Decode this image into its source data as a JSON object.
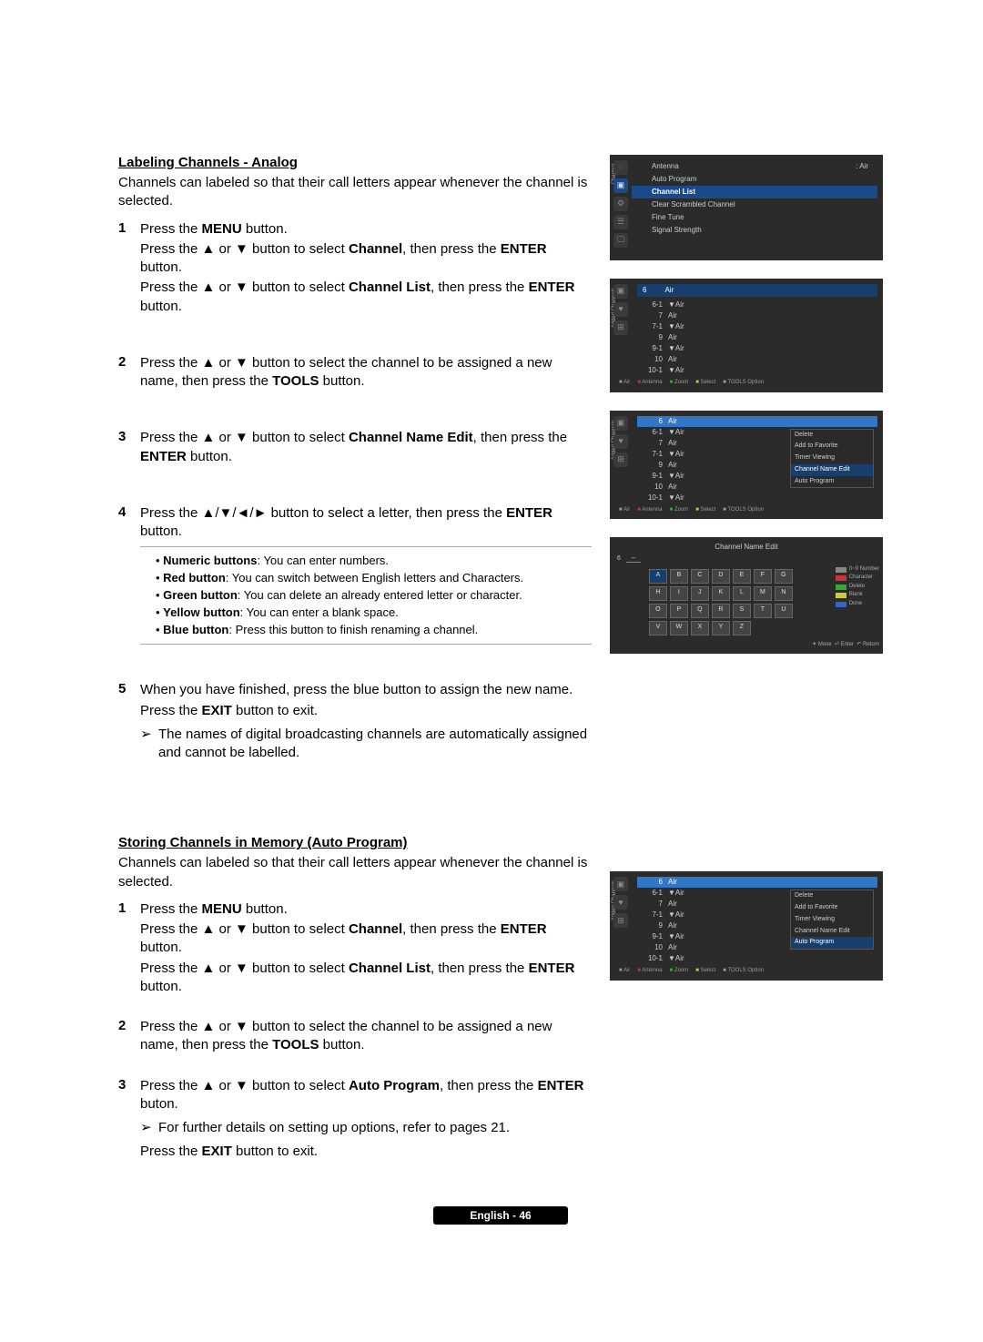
{
  "labeling": {
    "title": "Labeling Channels - Analog",
    "intro": "Channels can labeled so that their call letters appear whenever the channel is selected.",
    "steps": {
      "s1": {
        "l1a": "Press the ",
        "l1b": "MENU",
        "l1c": " button.",
        "l2a": "Press the ▲ or ▼ button to select ",
        "l2b": "Channel",
        "l2c": ", then press the ",
        "l2d": "ENTER",
        "l2e": " button.",
        "l3a": "Press the ▲ or ▼ button to select ",
        "l3b": "Channel List",
        "l3c": ", then press the ",
        "l3d": "ENTER",
        "l3e": " button."
      },
      "s2": {
        "l1a": "Press the ▲ or ▼ button to select the channel to be assigned a new name, then press the ",
        "l1b": "TOOLS",
        "l1c": " button."
      },
      "s3": {
        "l1a": "Press the ▲ or ▼ button to select ",
        "l1b": "Channel Name Edit",
        "l1c": ", then press the ",
        "l1d": "ENTER",
        "l1e": " button."
      },
      "s4": {
        "l1a": "Press the ▲/▼/◄/► button to select a letter, then press the ",
        "l1b": "ENTER",
        "l1c": " button.",
        "b1a": "Numeric buttons",
        "b1b": ": You can enter numbers.",
        "b2a": "Red button",
        "b2b": ": You can switch between English letters and Characters.",
        "b3a": "Green button",
        "b3b": ": You can delete an already entered letter or character.",
        "b4a": "Yellow button",
        "b4b": ": You can enter a blank space.",
        "b5a": "Blue button",
        "b5b": ": Press this button to finish renaming a channel."
      },
      "s5": {
        "l1": "When you have finished, press the blue button to assign the new name.",
        "l2a": "Press the ",
        "l2b": "EXIT",
        "l2c": " button to exit.",
        "note": "The names of digital broadcasting channels are automatically assigned and cannot be labelled."
      }
    }
  },
  "storing": {
    "title": "Storing Channels in Memory (Auto Program)",
    "intro": "Channels can labeled so that their call letters appear whenever the channel is selected.",
    "steps": {
      "s1": {
        "l1a": "Press the ",
        "l1b": "MENU",
        "l1c": " button.",
        "l2a": "Press the ▲ or ▼ button to select ",
        "l2b": "Channel",
        "l2c": ", then press the ",
        "l2d": "ENTER",
        "l2e": " button.",
        "l3a": "Press the ▲ or ▼ button to select ",
        "l3b": "Channel List",
        "l3c": ", then press the ",
        "l3d": "ENTER",
        "l3e": " button."
      },
      "s2": {
        "l1a": "Press the ▲ or ▼ button to select the channel to be assigned a new name, then press the ",
        "l1b": "TOOLS",
        "l1c": " button."
      },
      "s3": {
        "l1a": "Press the ▲ or ▼ button to select ",
        "l1b": "Auto Program",
        "l1c": ", then press the ",
        "l1d": "ENTER",
        "l1e": " buton.",
        "note": "For further details on setting up options, refer to pages 21.",
        "l2a": "Press the ",
        "l2b": "EXIT",
        "l2c": " button to exit."
      }
    }
  },
  "footer": "English - 46",
  "shot_menu": {
    "vlabel": "Channel",
    "items": [
      {
        "label": "Antenna",
        "value": ": Air"
      },
      {
        "label": "Auto Program",
        "value": ""
      },
      {
        "label": "Channel List",
        "value": "",
        "hl": true
      },
      {
        "label": "Clear Scrambled Channel",
        "value": ""
      },
      {
        "label": "Fine Tune",
        "value": ""
      },
      {
        "label": "Signal Strength",
        "value": ""
      }
    ]
  },
  "shot_list": {
    "vlabel": "Added Channels",
    "headerNum": "6",
    "headerName": "Air",
    "rows": [
      {
        "c1": "6-1",
        "c2": "▼Air"
      },
      {
        "c1": "7",
        "c2": "Air"
      },
      {
        "c1": "7-1",
        "c2": "▼Air"
      },
      {
        "c1": "9",
        "c2": "Air"
      },
      {
        "c1": "9-1",
        "c2": "▼Air"
      },
      {
        "c1": "10",
        "c2": "Air"
      },
      {
        "c1": "10-1",
        "c2": "▼Air"
      }
    ],
    "hints": {
      "a": "Air",
      "r": "Antenna",
      "g": "Zoom",
      "y": "Select",
      "opt": "TOOLS Option"
    }
  },
  "shot_popup": {
    "items": [
      {
        "label": "Delete"
      },
      {
        "label": "Add to Favorite"
      },
      {
        "label": "Timer Viewing"
      },
      {
        "label": "Channel Name Edit",
        "hl_cne": true
      },
      {
        "label": "Auto Program",
        "hl_ap": true
      }
    ]
  },
  "shot_kb": {
    "title": "Channel Name Edit",
    "ch": "6",
    "dash": "--",
    "rows": [
      [
        "A",
        "B",
        "C",
        "D",
        "E",
        "F",
        "G"
      ],
      [
        "H",
        "I",
        "J",
        "K",
        "L",
        "M",
        "N"
      ],
      [
        "O",
        "P",
        "Q",
        "R",
        "S",
        "T",
        "U"
      ],
      [
        "V",
        "W",
        "X",
        "Y",
        "Z",
        "",
        ""
      ]
    ],
    "legend": [
      {
        "c": "#888",
        "t": "0~9 Number"
      },
      {
        "c": "#c33",
        "t": "Character"
      },
      {
        "c": "#3a3",
        "t": "Delete"
      },
      {
        "c": "#cc3",
        "t": "Blank"
      },
      {
        "c": "#36c",
        "t": "Done"
      }
    ],
    "foot": {
      "m": "✦ Move",
      "e": "⏎ Enter",
      "r": "↶ Return"
    }
  }
}
